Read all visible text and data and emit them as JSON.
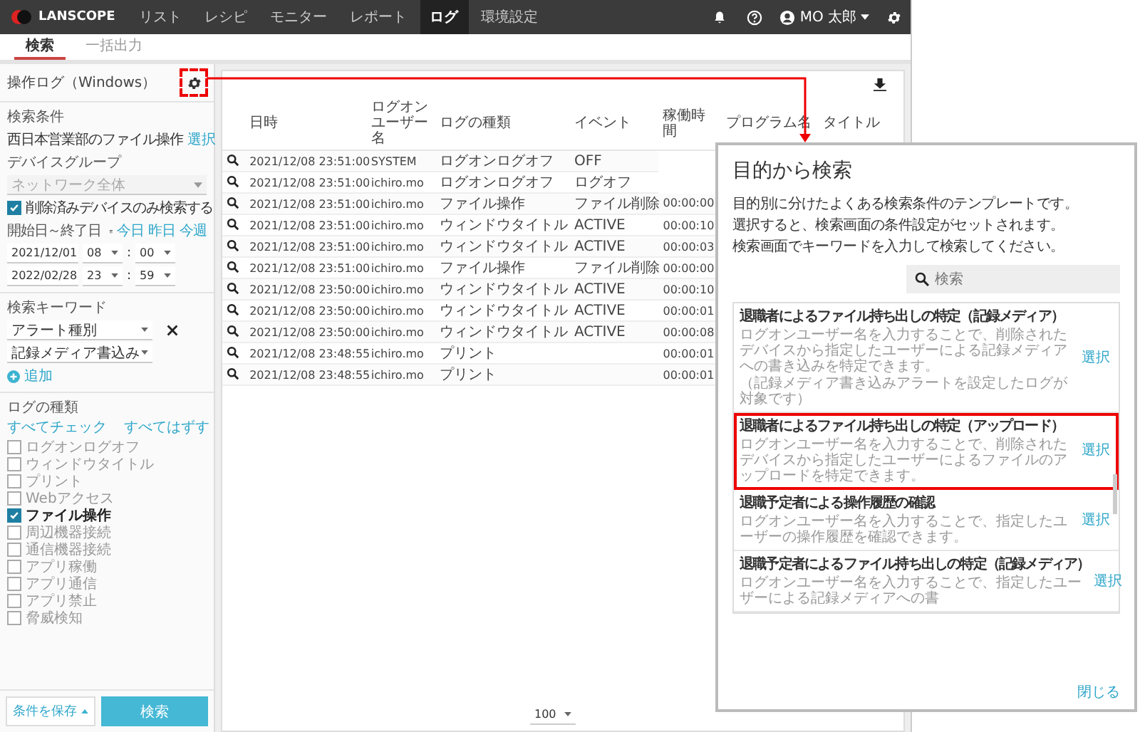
{
  "nav": {
    "logo": "LANSCOPE",
    "items": [
      {
        "label": "リスト",
        "selected": false
      },
      {
        "label": "レシピ",
        "selected": false
      },
      {
        "label": "モニター",
        "selected": false
      },
      {
        "label": "レポート",
        "selected": false
      },
      {
        "label": "ログ",
        "selected": true
      },
      {
        "label": "環境設定",
        "selected": false
      }
    ],
    "user": "MO 太郎"
  },
  "subtabs": [
    {
      "label": "検索",
      "selected": true
    },
    {
      "label": "一括出力",
      "selected": false
    }
  ],
  "sidebar": {
    "title": "操作ログ（Windows）",
    "conditions_label": "検索条件",
    "condition": "西日本営業部のファイル操作",
    "condition_link": "選択",
    "device_group_label": "デバイスグループ",
    "device_group": {
      "value": "ネットワーク全体",
      "disabled": true
    },
    "deleted_only": {
      "label": "削除済みデバイスのみ検索する",
      "checked": true
    },
    "period_label": "開始日～終了日",
    "period_links": [
      "今日",
      "昨日",
      "今週"
    ],
    "period_rows": [
      {
        "date": "2021/12/01",
        "hour": "08",
        "separator": ":",
        "minute": "00"
      },
      {
        "date": "2022/02/28",
        "hour": "23",
        "separator": ":",
        "minute": "59"
      }
    ],
    "keyword_label": "検索キーワード",
    "keywords": [
      "アラート種別",
      "記録メディア書込み"
    ],
    "add": "追加",
    "log_types_label": "ログの種類",
    "check_all": "すべてチェック",
    "uncheck_all": "すべてはずす",
    "log_types": [
      {
        "label": "ログオンログオフ",
        "checked": false
      },
      {
        "label": "ウィンドウタイトル",
        "checked": false
      },
      {
        "label": "プリント",
        "checked": false
      },
      {
        "label": "Webアクセス",
        "checked": false
      },
      {
        "label": "ファイル操作",
        "checked": true
      },
      {
        "label": "周辺機器接続",
        "checked": false
      },
      {
        "label": "通信機器接続",
        "checked": false
      },
      {
        "label": "アプリ稼働",
        "checked": false
      },
      {
        "label": "アプリ通信",
        "checked": false
      },
      {
        "label": "アプリ禁止",
        "checked": false
      },
      {
        "label": "脅威検知",
        "checked": false
      }
    ],
    "save_button": "条件を保存",
    "search_button": "検索"
  },
  "table": {
    "columns": [
      "日時",
      "ログオンユーザー名",
      "ログの種類",
      "イベント",
      "稼働時間",
      "プログラム名",
      "タイトル"
    ],
    "rows": [
      [
        "2021/12/08 23:51:00",
        "SYSTEM",
        "ログオンログオフ",
        "OFF"
      ],
      [
        "2021/12/08 23:51:00",
        "ichiro.mo",
        "ログオンログオフ",
        "ログオフ"
      ],
      [
        "2021/12/08 23:51:00",
        "ichiro.mo",
        "ファイル操作",
        "ファイル削除",
        "00:00:00"
      ],
      [
        "2021/12/08 23:51:00",
        "ichiro.mo",
        "ウィンドウタイトル",
        "ACTIVE",
        "00:00:10"
      ],
      [
        "2021/12/08 23:51:00",
        "ichiro.mo",
        "ウィンドウタイトル",
        "ACTIVE",
        "00:00:03"
      ],
      [
        "2021/12/08 23:51:00",
        "ichiro.mo",
        "ファイル操作",
        "ファイル削除",
        "00:00:00"
      ],
      [
        "2021/12/08 23:50:00",
        "ichiro.mo",
        "ウィンドウタイトル",
        "ACTIVE",
        "00:00:10"
      ],
      [
        "2021/12/08 23:50:00",
        "ichiro.mo",
        "ウィンドウタイトル",
        "ACTIVE",
        "00:00:01"
      ],
      [
        "2021/12/08 23:50:00",
        "ichiro.mo",
        "ウィンドウタイトル",
        "ACTIVE",
        "00:00:08"
      ],
      [
        "2021/12/08 23:48:55",
        "ichiro.mo",
        "プリント",
        "",
        "00:00:01"
      ],
      [
        "2021/12/08 23:48:55",
        "ichiro.mo",
        "プリント",
        "",
        "00:00:01"
      ]
    ],
    "page_size": "100"
  },
  "dialog": {
    "title": "目的から検索",
    "description": [
      "目的別に分けたよくある検索条件のテンプレートです。",
      "選択すると、検索画面の条件設定がセットされます。",
      "検索画面でキーワードを入力して検索してください。"
    ],
    "search": {
      "placeholder": "検索"
    },
    "templates": [
      {
        "title": "退職者によるファイル持ち出しの特定（記録メディア）",
        "description": "ログオンユーザー名を入力することで、削除されたデバイスから指定したユーザーによる記録メディアへの書き込みを特定できます。",
        "note": "（記録メディア書き込みアラートを設定したログが対象です）",
        "action": "選択",
        "highlighted": false
      },
      {
        "title": "退職者によるファイル持ち出しの特定（アップロード）",
        "description": "ログオンユーザー名を入力することで、削除されたデバイスから指定したユーザーによるファイルのアップロードを特定できます。",
        "action": "選択",
        "highlighted": true
      },
      {
        "title": "退職予定者による操作履歴の確認",
        "description": "ログオンユーザー名を入力することで、指定したユーザーの操作履歴を確認できます。",
        "action": "選択",
        "highlighted": false
      },
      {
        "title": "退職予定者によるファイル持ち出しの特定（記録メディア）",
        "description": "ログオンユーザー名を入力することで、指定したユーザーによる記録メディアへの書",
        "action": "選択",
        "highlighted": false
      }
    ],
    "close": "閉じる"
  }
}
